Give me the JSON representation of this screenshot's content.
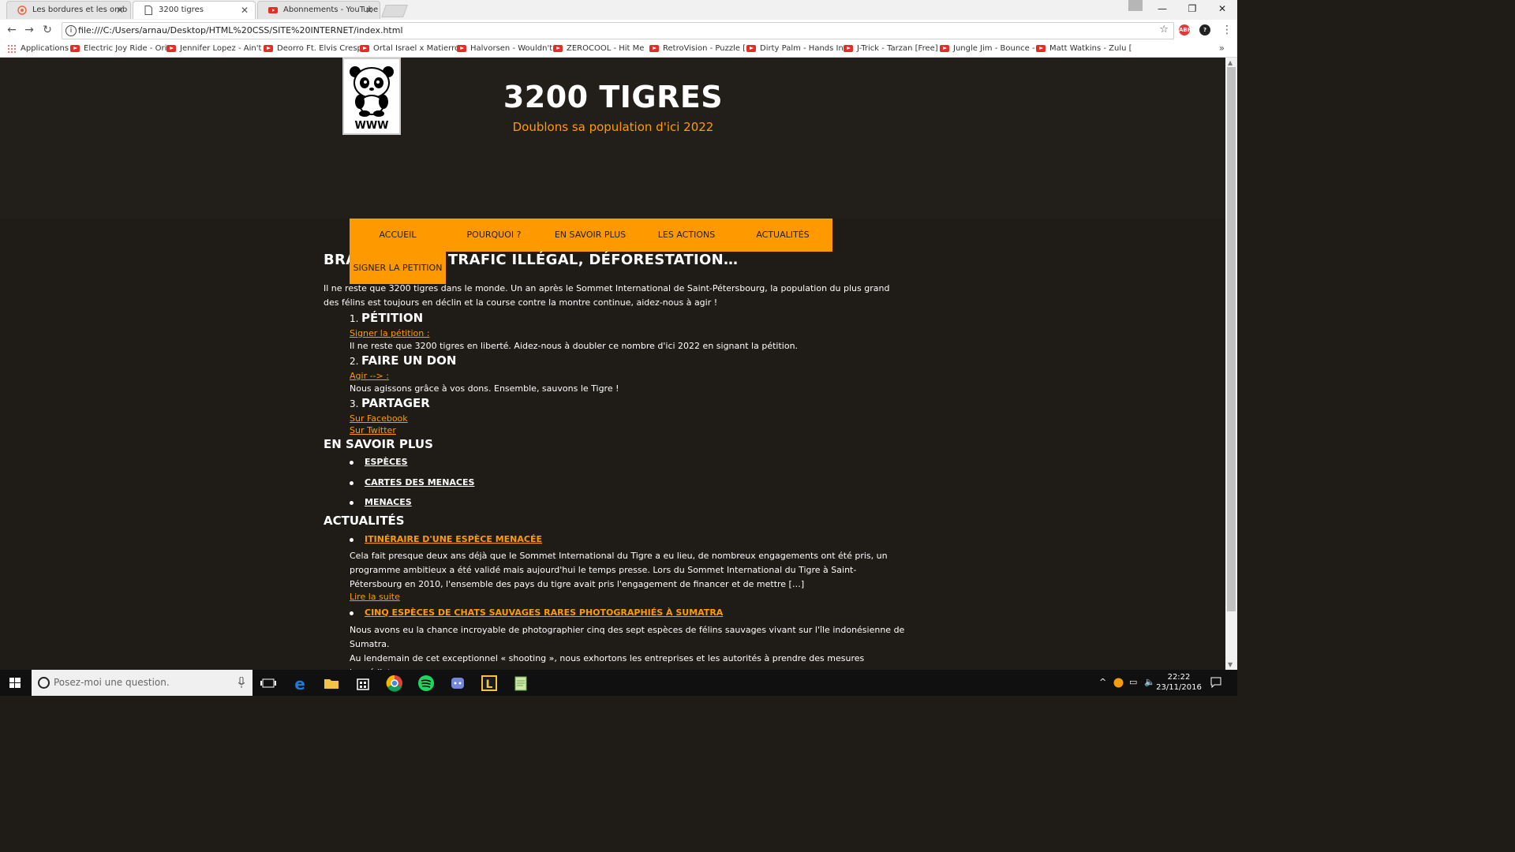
{
  "browser": {
    "tabs": [
      {
        "title": "Les bordures et les ombres",
        "favicon": "sitepoint-icon"
      },
      {
        "title": "3200 tigres",
        "favicon": "page-icon"
      },
      {
        "title": "Abonnements - YouTube",
        "favicon": "youtube-icon"
      }
    ],
    "url": "file:///C:/Users/arnau/Desktop/HTML%20CSS/SITE%20INTERNET/index.html",
    "bookmarks": [
      "Applications",
      "Electric Joy Ride - Orig",
      "Jennifer Lopez - Ain't",
      "Deorro Ft. Elvis Cresp",
      "Ortal Israel x Matierro",
      "Halvorsen - Wouldn't",
      "ZEROCOOL - Hit Me",
      "RetroVision - Puzzle [",
      "Dirty Palm - Hands In",
      "J-Trick - Tarzan [Free]",
      "Jungle Jim - Bounce -",
      "Matt Watkins - Zulu ["
    ],
    "extensions": [
      {
        "label": "ABP",
        "color": "#e23a3a"
      },
      {
        "label": "?",
        "color": "#222222"
      }
    ]
  },
  "site": {
    "title": "3200 TIGRES",
    "subtitle": "Doublons sa population d'ici 2022",
    "logo_text": "WWW",
    "nav": [
      "ACCUEIL",
      "POURQUOI ?",
      "EN SAVOIR PLUS",
      "LES ACTIONS",
      "ACTUALITÉS"
    ],
    "nav_overflow": "SIGNER LA PETITION",
    "headline": "BRACONNAGE, TRAFIC ILLÉGAL, DÉFORESTATION…",
    "intro": "Il ne reste que 3200 tigres dans le monde. Un an après le Sommet International de Saint-Pétersbourg, la population du plus grand des félins est toujours en déclin et la course contre la montre continue, aidez-nous à agir !",
    "steps": [
      {
        "num": "1.",
        "heading": "PÉTITION",
        "link": "Signer la pétition :",
        "text": "Il ne reste que 3200 tigres en liberté. Aidez-nous à doubler ce nombre d'ici 2022 en signant la pétition."
      },
      {
        "num": "2.",
        "heading": "FAIRE UN DON",
        "link": "Agir --> :",
        "text": "Nous agissons grâce à vos dons. Ensemble, sauvons le Tigre !"
      },
      {
        "num": "3.",
        "heading": "PARTAGER",
        "link": "Sur Facebook ",
        "link2": "Sur Twitter"
      }
    ],
    "learn_more": {
      "heading": "EN SAVOIR PLUS",
      "items": [
        "ESPÈCES",
        "CARTES DES MENACES",
        "MENACES"
      ]
    },
    "news": {
      "heading": "ACTUALITÉS",
      "items": [
        {
          "title": "ITINÉRAIRE D'UNE ESPÈCE MENACÉE",
          "text": "Cela fait presque deux ans déjà que le Sommet International du Tigre a eu lieu, de nombreux engagements ont été pris, un programme ambitieux a été validé mais aujourd'hui le temps presse. Lors du Sommet International du Tigre à Saint-Pétersbourg en 2010, l'ensemble des pays du tigre avait pris l'engagement de financer et de mettre […]",
          "more": "Lire la suite"
        },
        {
          "title": "CINQ ESPÈCES DE CHATS SAUVAGES RARES PHOTOGRAPHIÉS À SUMATRA",
          "text": "Nous avons eu la chance incroyable de photographier cinq des sept espèces de félins sauvages vivant sur l'île indonésienne de Sumatra.",
          "text2": "Au lendemain de cet exceptionnel « shooting », nous exhortons les entreprises et les autorités à prendre des mesures immédiates"
        }
      ]
    }
  },
  "taskbar": {
    "search_placeholder": "Posez-moi une question.",
    "time": "22:22",
    "date": "23/11/2016"
  },
  "colors": {
    "accent": "#ff9900",
    "page_bg": "#1f1b17"
  }
}
